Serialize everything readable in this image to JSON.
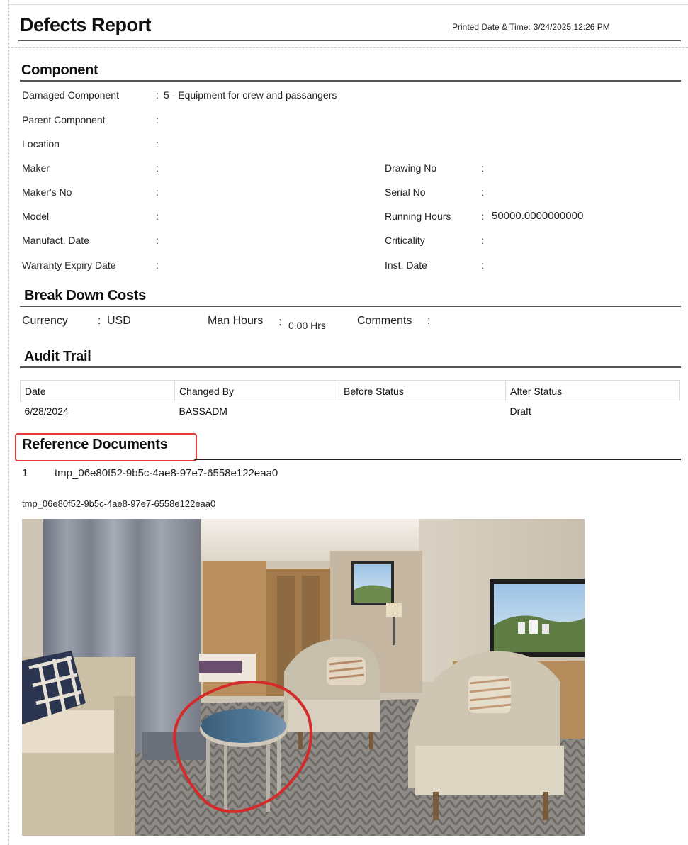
{
  "header": {
    "title": "Defects Report",
    "printed_label": "Printed Date & Time:",
    "printed_value": "3/24/2025 12:26 PM"
  },
  "component": {
    "heading": "Component",
    "fields_left": [
      {
        "label": "Damaged Component",
        "value": "5 - Equipment for crew and passangers"
      },
      {
        "label": "Parent Component",
        "value": ""
      },
      {
        "label": "Location",
        "value": ""
      },
      {
        "label": "Maker",
        "value": ""
      },
      {
        "label": "Maker's No",
        "value": ""
      },
      {
        "label": "Model",
        "value": ""
      },
      {
        "label": "Manufact. Date",
        "value": ""
      },
      {
        "label": "Warranty Expiry Date",
        "value": ""
      }
    ],
    "fields_right": [
      {
        "label": "Drawing No",
        "value": ""
      },
      {
        "label": "Serial No",
        "value": ""
      },
      {
        "label": "Running Hours",
        "value": "50000.0000000000"
      },
      {
        "label": "Criticality",
        "value": ""
      },
      {
        "label": "Inst. Date",
        "value": ""
      }
    ]
  },
  "breakdown": {
    "heading": "Break Down Costs",
    "currency_label": "Currency",
    "currency_value": "USD",
    "manhours_label": "Man Hours",
    "manhours_value": "0.00 Hrs",
    "comments_label": "Comments",
    "comments_value": ""
  },
  "audit": {
    "heading": "Audit Trail",
    "columns": [
      "Date",
      "Changed By",
      "Before Status",
      "After Status"
    ],
    "rows": [
      [
        "6/28/2024",
        "BASSADM",
        "",
        "Draft"
      ]
    ]
  },
  "reference": {
    "heading": "Reference Documents",
    "items": [
      {
        "index": "1",
        "name": "tmp_06e80f52-9b5c-4ae8-97e7-6558e122eaa0"
      }
    ],
    "image_caption": "tmp_06e80f52-9b5c-4ae8-97e7-6558e122eaa0",
    "highlight_color": "#e23a3a"
  },
  "colon": ":"
}
